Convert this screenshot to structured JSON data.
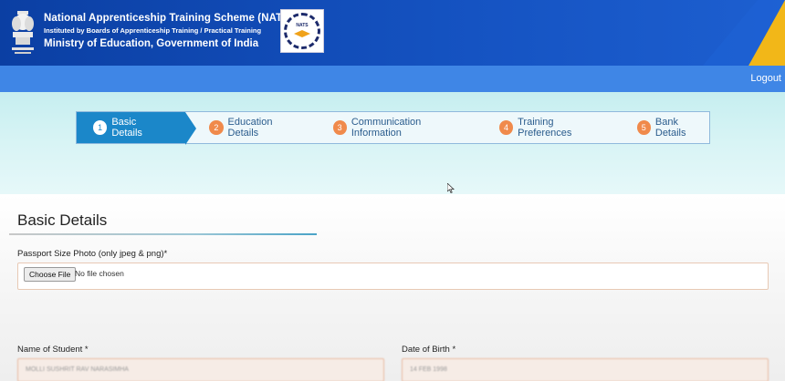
{
  "header": {
    "title": "National Apprenticeship Training Scheme (NATS)",
    "subtitle": "Instituted by Boards of Apprenticeship Training / Practical Training",
    "ministry": "Ministry of Education, Government of India",
    "logo_text": "NATS",
    "colors": {
      "header_bg": "#0b3fa3",
      "accent_corner": "#f2b718"
    }
  },
  "nav": {
    "logout_label": "Logout"
  },
  "steps": [
    {
      "num": "1",
      "label": "Basic Details",
      "active": true
    },
    {
      "num": "2",
      "label": "Education Details",
      "active": false
    },
    {
      "num": "3",
      "label": "Communication Information",
      "active": false
    },
    {
      "num": "4",
      "label": "Training Preferences",
      "active": false
    },
    {
      "num": "5",
      "label": "Bank Details",
      "active": false
    }
  ],
  "form": {
    "section_title": "Basic Details",
    "photo_label": "Passport Size Photo (only jpeg & png)*",
    "choose_file_label": "Choose File",
    "no_file_text": "No file chosen",
    "name_label": "Name of Student *",
    "name_value": "MOLLI SUSHRIT RAV NARASIMHA",
    "dob_label": "Date of Birth *",
    "dob_value": "14 FEB 1998"
  }
}
